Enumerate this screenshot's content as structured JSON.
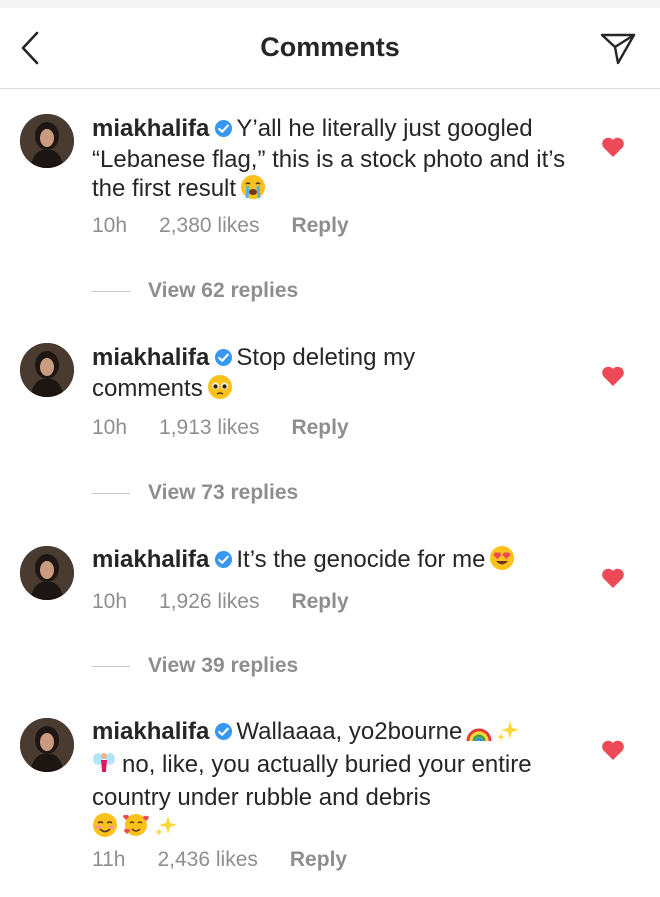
{
  "header": {
    "title": "Comments"
  },
  "comments": [
    {
      "username": "miakhalifa",
      "text": "Y’all he literally just googled “Lebanese flag,” this is a stock photo and it’s the first result",
      "emoji": "loudly-crying-face",
      "time": "10h",
      "likes": "2,380 likes",
      "reply": "Reply",
      "view_replies": "View 62 replies"
    },
    {
      "username": "miakhalifa",
      "text": "Stop deleting my comments",
      "emoji": "pleading-face",
      "time": "10h",
      "likes": "1,913 likes",
      "reply": "Reply",
      "view_replies": "View 73 replies"
    },
    {
      "username": "miakhalifa",
      "text": "It’s the genocide for me",
      "emoji": "heart-eyes-face",
      "time": "10h",
      "likes": "1,926 likes",
      "reply": "Reply",
      "view_replies": "View 39 replies"
    },
    {
      "username": "miakhalifa",
      "text_line1": "Wallaaaa, yo2bourne",
      "text_line2": "no, like, you actually buried your entire country under rubble and debris",
      "emojis_after_line1": [
        "rainbow",
        "sparkles"
      ],
      "emoji_start_line2": "fairy",
      "emojis_end": [
        "smiling-face",
        "smiling-face-with-hearts",
        "sparkles"
      ],
      "time": "11h",
      "likes": "2,436 likes",
      "reply": "Reply"
    }
  ],
  "colors": {
    "heart": "#ed4956",
    "verified": "#3897f0",
    "meta_gray": "#8e8e8e",
    "text": "#262626"
  },
  "icons": {
    "back": "chevron-left-icon",
    "share": "paper-plane-icon",
    "like": "heart-icon",
    "verified": "verified-badge-icon"
  }
}
